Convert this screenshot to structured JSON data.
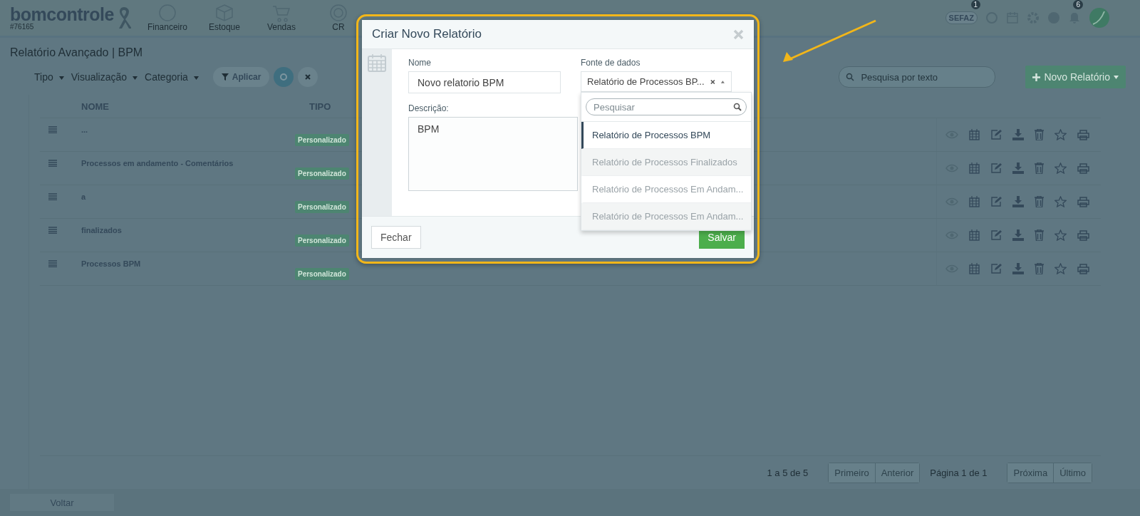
{
  "top_bar": {
    "logo": "bomcontrole",
    "account_id": "#76165",
    "nav_items": [
      "Financeiro",
      "Estoque",
      "Vendas",
      "CR"
    ],
    "sefaz_label": "SEFAZ",
    "sefaz_count": "1",
    "notification_count": "6"
  },
  "page_title": "Relatório Avançado | BPM",
  "filters": [
    "Tipo",
    "Visualização",
    "Categoria"
  ],
  "apply_button": "Aplicar",
  "search": {
    "placeholder": "Pesquisa por texto"
  },
  "new_button": "Novo Relatório",
  "table": {
    "columns": [
      "NOME",
      "TIPO"
    ],
    "rows": [
      {
        "name": "...",
        "type": "Personalizado"
      },
      {
        "name": "Processos em andamento - Comentários",
        "type": "Personalizado"
      },
      {
        "name": "a",
        "type": "Personalizado"
      },
      {
        "name": "finalizados",
        "type": "Personalizado"
      },
      {
        "name": "Processos BPM",
        "type": "Personalizado"
      }
    ]
  },
  "pagination": {
    "summary": "1 a 5 de 5",
    "first_group": [
      {
        "label": "Primeiro",
        "disabled": true
      },
      {
        "label": "Anterior",
        "disabled": true
      }
    ],
    "page_label": "Página 1 de 1",
    "last_group": [
      {
        "label": "Próxima",
        "disabled": true
      },
      {
        "label": "Último",
        "disabled": true
      }
    ]
  },
  "back_button": "Voltar",
  "dialog": {
    "title": "Criar Novo Relatório",
    "name_label": "Nome",
    "name_value": "Novo relatorio BPM",
    "source_label": "Fonte de dados",
    "source_value": "Relatório de Processos BP...",
    "description_label": "Descrição:",
    "description_value": "BPM",
    "dropdown": {
      "search_placeholder": "Pesquisar",
      "options": [
        {
          "label": "Relatório de Processos BPM",
          "selected": true
        },
        {
          "label": "Relatório de Processos Finalizados",
          "selected": false
        },
        {
          "label": "Relatório de Processos Em Andam...",
          "selected": false
        },
        {
          "label": "Relatório de Processos Em Andam...",
          "selected": false
        }
      ]
    },
    "close_button": "Fechar",
    "save_button": "Salvar"
  }
}
